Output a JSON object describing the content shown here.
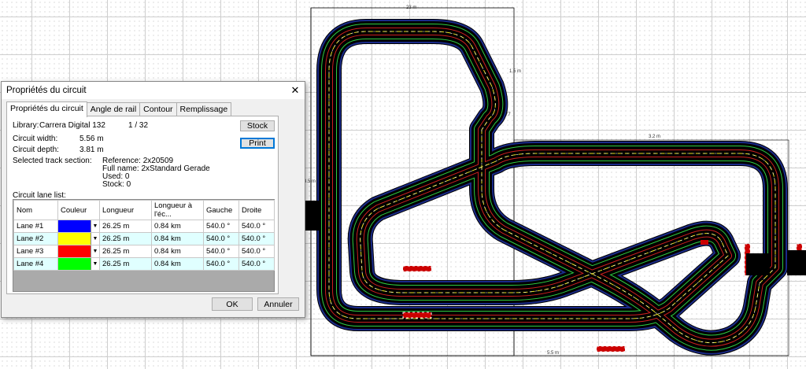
{
  "dialog": {
    "title": "Propriétés du circuit",
    "close_glyph": "✕",
    "tabs": [
      "Propriétés du circuit",
      "Angle de rail",
      "Contour",
      "Remplissage"
    ],
    "library_label": "Library:",
    "library_value": "Carrera Digital 132",
    "page_indicator": "1 / 32",
    "width_label": "Circuit width:",
    "width_value": "5.56 m",
    "depth_label": "Circuit depth:",
    "depth_value": "3.81 m",
    "selected_label": "Selected track section:",
    "selected_reference": "Reference: 2x20509",
    "selected_fullname": "Full name: 2xStandard Gerade",
    "selected_used": "Used: 0",
    "selected_stock": "Stock: 0",
    "stock_button": "Stock",
    "print_button": "Print",
    "lane_list_label": "Circuit lane list:",
    "table_headers": [
      "Nom",
      "Couleur",
      "Longueur",
      "Longueur à l'éc...",
      "Gauche",
      "Droite"
    ],
    "lanes": [
      {
        "name": "Lane #1",
        "color": "#0000ff",
        "length": "26.25 m",
        "scale_length": "0.84 km",
        "left": "540.0 °",
        "right": "540.0 °"
      },
      {
        "name": "Lane #2",
        "color": "#ffff00",
        "length": "26.25 m",
        "scale_length": "0.84 km",
        "left": "540.0 °",
        "right": "540.0 °"
      },
      {
        "name": "Lane #3",
        "color": "#ff0000",
        "length": "26.25 m",
        "scale_length": "0.84 km",
        "left": "540.0 °",
        "right": "540.0 °"
      },
      {
        "name": "Lane #4",
        "color": "#00ff00",
        "length": "26.25 m",
        "scale_length": "0.84 km",
        "left": "540.0 °",
        "right": "540.0 °"
      }
    ],
    "ok_button": "OK",
    "cancel_button": "Annuler"
  },
  "dimensions": {
    "top": "23 m",
    "right_upper": "1.5 m",
    "mid": "3.2 m",
    "left": "3.5 m",
    "bottom": "5.5 m",
    "marker": "77"
  }
}
